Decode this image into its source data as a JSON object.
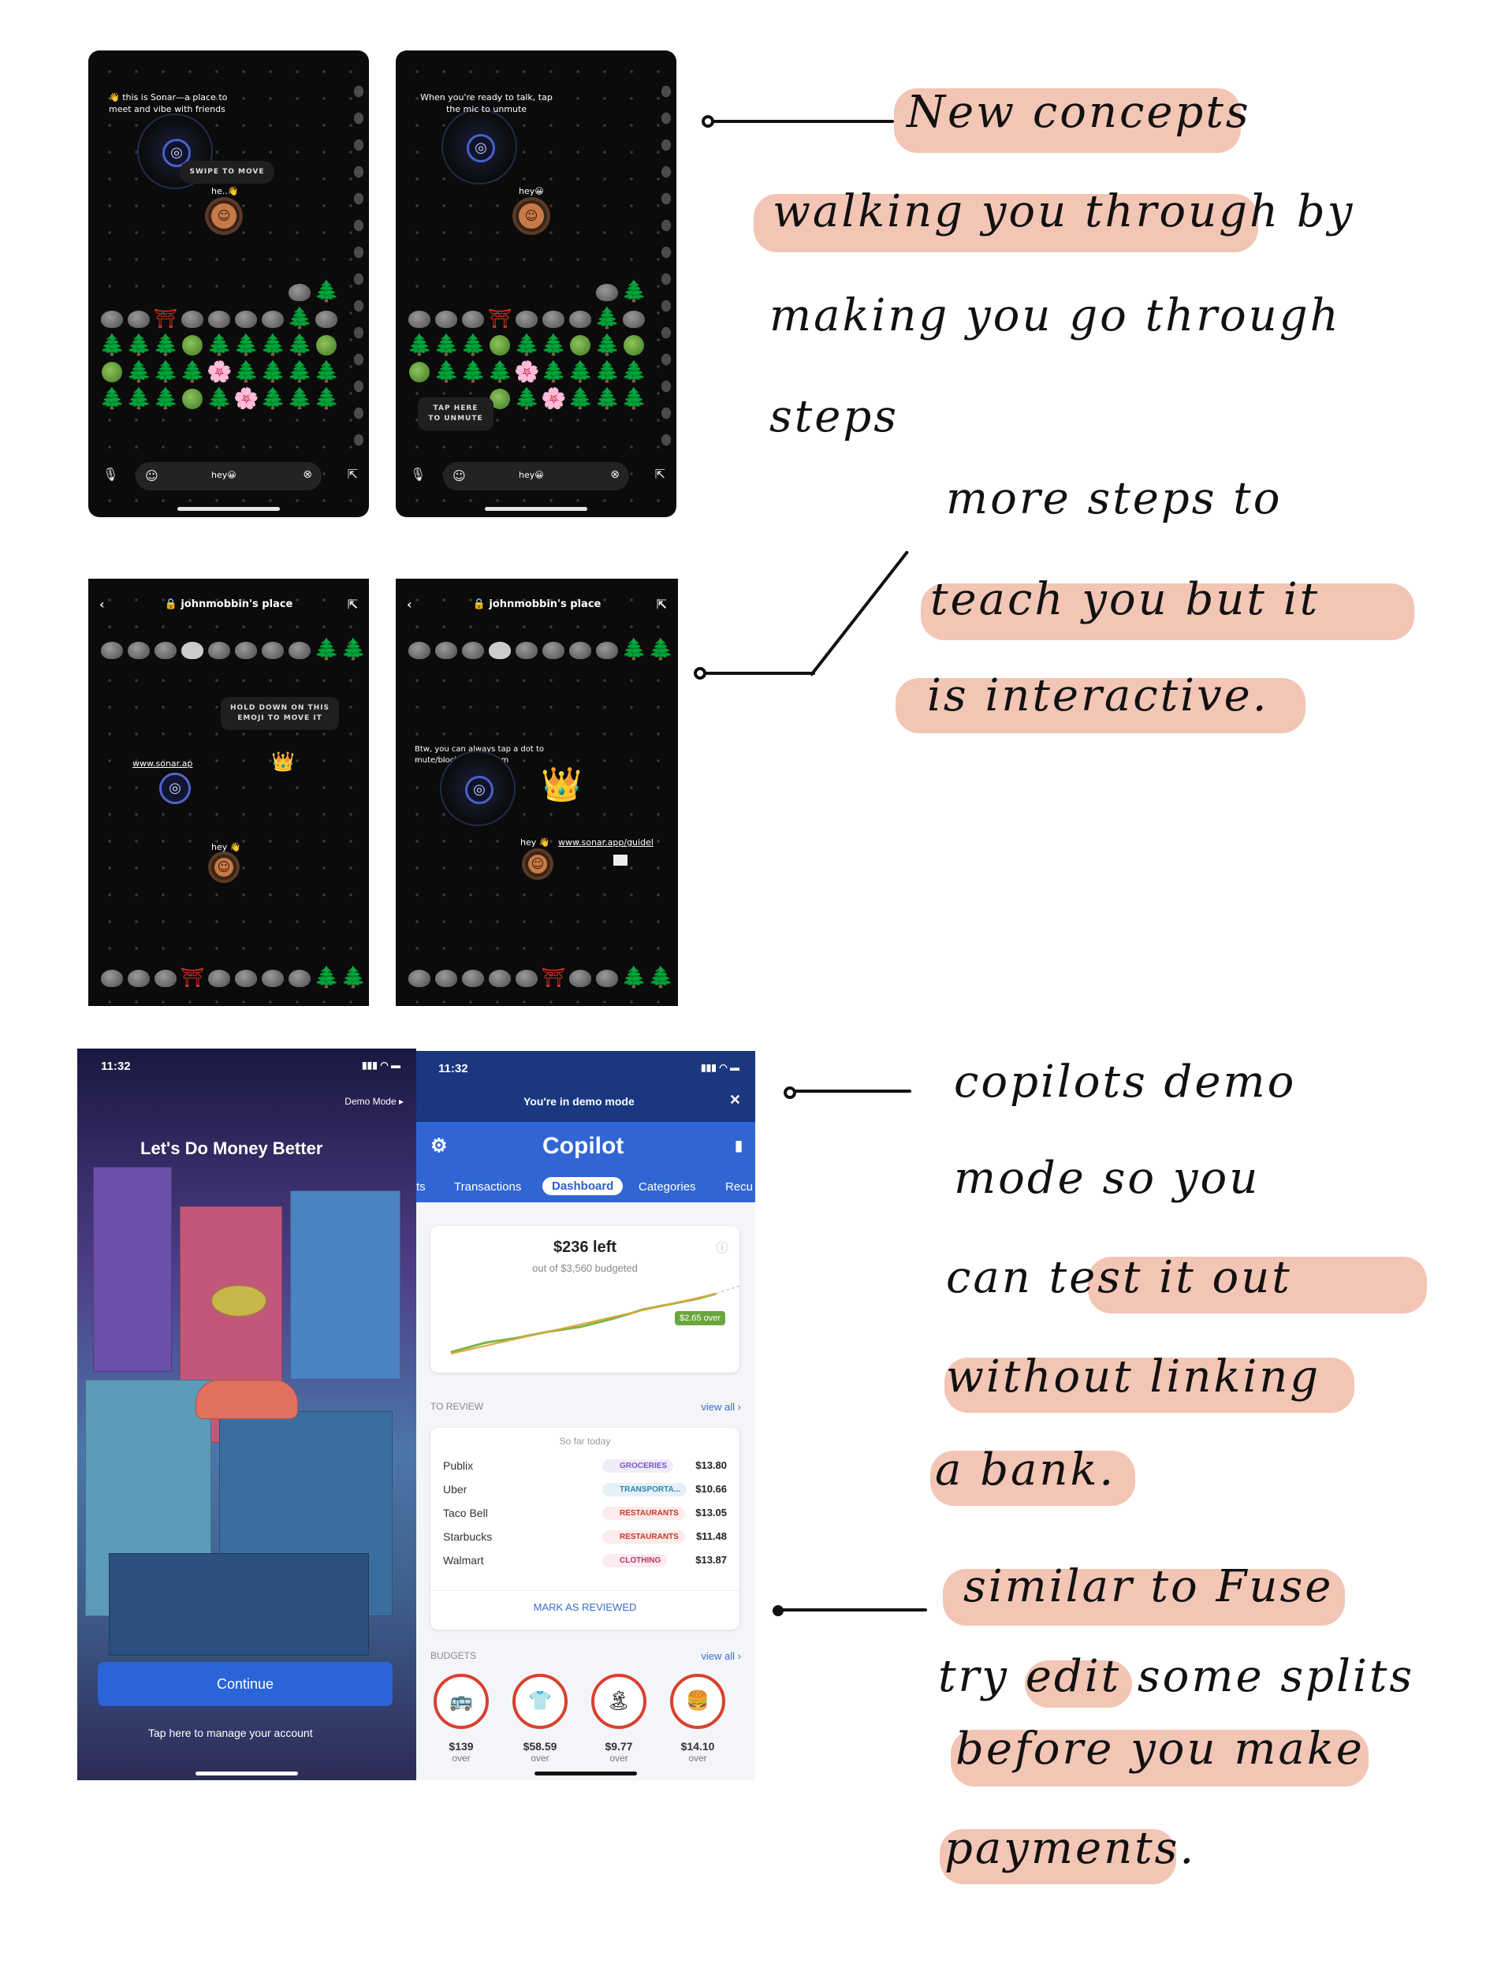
{
  "sonar1": {
    "intro": "👋 this is Sonar—a place to meet and vibe with friends",
    "swipe_hint": "SWIPE TO MOVE",
    "bubble": "he..👋",
    "input_text": "hey😀"
  },
  "sonar2": {
    "intro": "When you're ready to talk, tap the mic to unmute",
    "bubble": "hey😀",
    "unmute_hint": "TAP HERE TO UNMUTE",
    "input_text": "hey😀"
  },
  "sonar3": {
    "title": "🔒 johnmobbin's place",
    "hold_hint": "HOLD DOWN ON THIS EMOJI TO MOVE IT",
    "link": "www.sonar.ap",
    "bubble": "hey 👋"
  },
  "sonar4": {
    "title": "🔒 johnmobbin's place",
    "dot_hint": "Btw, you can always tap a dot to mute/block/report them",
    "bubble": "hey 👋",
    "link": "www.sonar.app/guidel"
  },
  "copilot_left": {
    "time": "11:32",
    "demo_link": "Demo Mode ▸",
    "headline": "Let's Do Money Better",
    "continue": "Continue",
    "manage": "Tap here to manage your account"
  },
  "copilot_right": {
    "time": "11:32",
    "demo_banner": "You're in demo mode",
    "app_title": "Copilot",
    "tabs": [
      "ts",
      "Transactions",
      "Dashboard",
      "Categories",
      "Recu"
    ],
    "left_amount": "$236 left",
    "budgeted": "out of $3,560 budgeted",
    "over_badge": "$2.65 over",
    "to_review": "TO REVIEW",
    "view_all": "view all ›",
    "so_far": "So far today",
    "rows": [
      {
        "name": "Publix",
        "cat": "GROCERIES",
        "amt": "$13.80"
      },
      {
        "name": "Uber",
        "cat": "TRANSPORTA...",
        "amt": "$10.66"
      },
      {
        "name": "Taco Bell",
        "cat": "RESTAURANTS",
        "amt": "$13.05"
      },
      {
        "name": "Starbucks",
        "cat": "RESTAURANTS",
        "amt": "$11.48"
      },
      {
        "name": "Walmart",
        "cat": "CLOTHING",
        "amt": "$13.87"
      }
    ],
    "mark_reviewed": "MARK AS REVIEWED",
    "budgets": "BUDGETS",
    "budgets_view_all": "view all ›",
    "budget_items": [
      {
        "icon": "🚌",
        "val": "$139",
        "sub": "over"
      },
      {
        "icon": "👕",
        "val": "$58.59",
        "sub": "over"
      },
      {
        "icon": "🏝",
        "val": "$9.77",
        "sub": "over"
      },
      {
        "icon": "🍔",
        "val": "$14.10",
        "sub": "over"
      }
    ]
  },
  "notes": {
    "n1a": "New concepts",
    "n1b": "walking you through by",
    "n1c": "making you go through",
    "n1d": "steps",
    "n2a": "more steps to",
    "n2b": "teach you but it",
    "n2c": "is interactive.",
    "n3a": "copilots demo",
    "n3b": "mode so you",
    "n3c": "can test it out",
    "n3d": "without linking",
    "n3e": "a bank.",
    "n4a": "similar to Fuse",
    "n4b": "try edit some splits",
    "n4c": "before you make",
    "n4d": "payments."
  },
  "colors": {
    "highlight": "#f3c5b4",
    "copilot_blue": "#3165d4",
    "sonar_bg": "#0b0b0b"
  }
}
